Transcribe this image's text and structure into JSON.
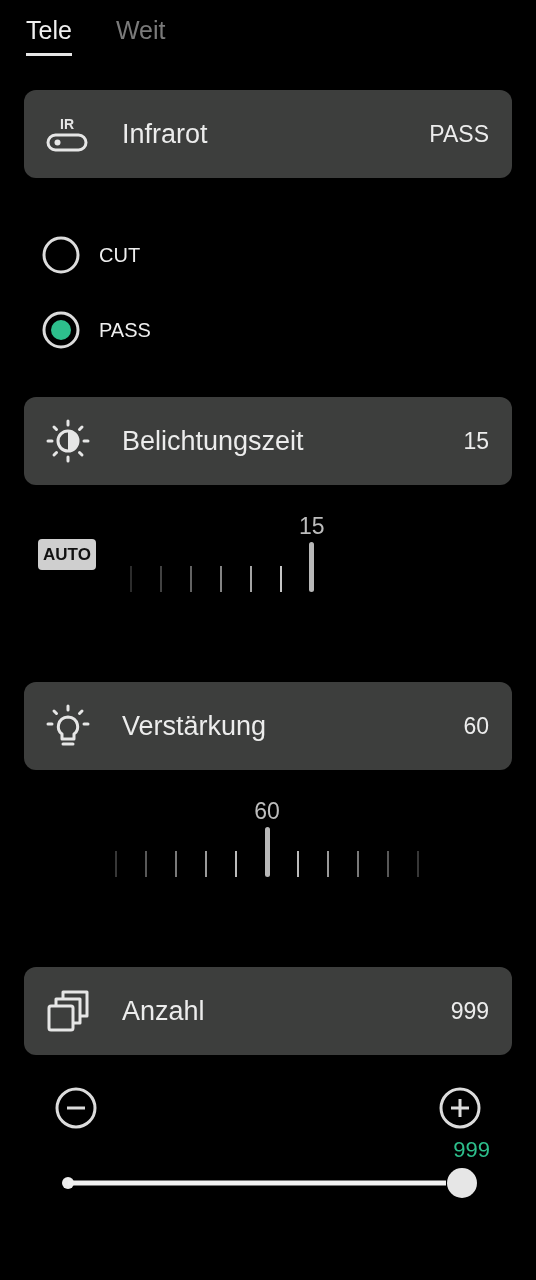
{
  "tabs": [
    {
      "label": "Tele",
      "selected": true
    },
    {
      "label": "Weit",
      "selected": false
    }
  ],
  "infrared": {
    "title": "Infrarot",
    "value": "PASS",
    "icon_text": "IR",
    "options": [
      {
        "label": "CUT",
        "selected": false
      },
      {
        "label": "PASS",
        "selected": true
      }
    ]
  },
  "exposure": {
    "title": "Belichtungszeit",
    "value": "15",
    "auto_badge": "AUTO",
    "dial_reading": "15"
  },
  "gain": {
    "title": "Verstärkung",
    "value": "60",
    "dial_reading": "60"
  },
  "count": {
    "title": "Anzahl",
    "value": "999",
    "slider_reading": "999",
    "level": 1.0
  }
}
